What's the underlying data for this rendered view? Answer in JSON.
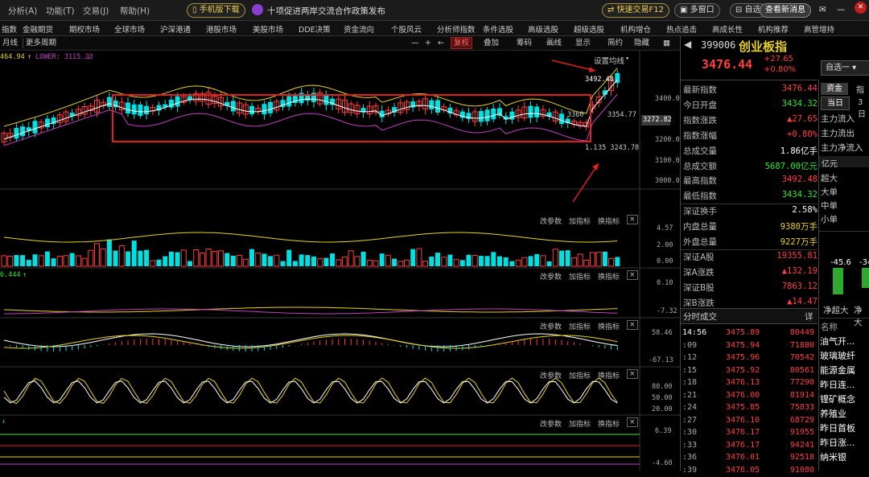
{
  "menubar": {
    "items": [
      "分析(A)",
      "功能(T)",
      "交易(J)",
      "帮助(H)"
    ],
    "mobile_btn": "手机版下载",
    "news": "十项促进两岸交流合作政策发布",
    "fast_trade": "快速交易F12",
    "multi_window": "多窗口",
    "self_select": "自选",
    "check_news": "查看新消息"
  },
  "navbar": {
    "items": [
      "指数",
      "金融期货",
      "期权市场",
      "全球市场",
      "沪深港通",
      "港股市场",
      "美股市场",
      "DDE决策",
      "资金流向",
      "个股风云",
      "分析师指数",
      "条件选股",
      "高级选股",
      "超级选股",
      "机构增仓",
      "热点追击",
      "高成长性",
      "机构推荐",
      "高管增持"
    ]
  },
  "toolbar": {
    "left": [
      "月线",
      "更多周期"
    ],
    "buttons": [
      "复权",
      "叠加",
      "筹码",
      "画线",
      "显示",
      "简约",
      "隐藏"
    ],
    "ma_setting": "设置均线"
  },
  "indicator": {
    "top_text": "464.94",
    "lower_text": "LOWER: 3115.23",
    "annot_high": "3492.48",
    "annot_mid_left": "3360",
    "annot_mid": "3354.77",
    "annot_low": "35 3243.78",
    "annot_low_prefix": "1.1",
    "sub2_text": "6.444"
  },
  "axis": {
    "main": [
      "3400.00",
      "3272.82",
      "3200.00",
      "3100.00",
      "3000.00"
    ],
    "vol": [
      "4.57",
      "2.00",
      "0.00"
    ],
    "sub2": [
      "0.10",
      "-7.32"
    ],
    "sub3": [
      "58.46",
      "-67.13"
    ],
    "sub4": [
      "80.00",
      "50.00",
      "20.00"
    ],
    "sub5": [
      "6.39",
      "-4.60"
    ]
  },
  "sub_controls": {
    "params": "改参数",
    "add": "加指标",
    "switch": "换指标",
    "close": "×"
  },
  "header": {
    "code": "399006",
    "name": "创业板指",
    "price": "3476.44",
    "change": "+27.65",
    "change_pct": "+0.80%",
    "select_btn": "自选一"
  },
  "stats": [
    {
      "k": "最新指数",
      "v": "3476.44",
      "c": "red"
    },
    {
      "k": "今日开盘",
      "v": "3434.32",
      "c": "green"
    },
    {
      "k": "指数涨跌",
      "v": "▲27.65",
      "c": "red"
    },
    {
      "k": "指数涨幅",
      "v": "+0.80%",
      "c": "red"
    },
    {
      "k": "总成交量",
      "v": "1.86亿手",
      "c": "white"
    },
    {
      "k": "总成交额",
      "v": "5687.00亿元",
      "c": "green"
    },
    {
      "k": "最高指数",
      "v": "3492.48",
      "c": "red"
    },
    {
      "k": "最低指数",
      "v": "3434.32",
      "c": "green"
    },
    {
      "k": "深证换手",
      "v": "2.58%",
      "c": "white"
    },
    {
      "k": "内盘总量",
      "v": "9380万手",
      "c": "yellowt"
    },
    {
      "k": "外盘总量",
      "v": "9227万手",
      "c": "yellowt"
    },
    {
      "k": "深证A股",
      "v": "19355.81",
      "c": "red"
    },
    {
      "k": "深A涨跌",
      "v": "▲132.19",
      "c": "red"
    },
    {
      "k": "深证B股",
      "v": "7863.12",
      "c": "red"
    },
    {
      "k": "深B涨跌",
      "v": "▲14.47",
      "c": "red"
    }
  ],
  "trades_title": "分时成交",
  "trades_detail": "详",
  "trades": [
    {
      "t": "14:56",
      "p": "3475.89",
      "v": "80449"
    },
    {
      "t": ":09",
      "p": "3475.94",
      "v": "71880"
    },
    {
      "t": ":12",
      "p": "3475.96",
      "v": "70542"
    },
    {
      "t": ":15",
      "p": "3475.92",
      "v": "80561"
    },
    {
      "t": ":18",
      "p": "3476.13",
      "v": "77290"
    },
    {
      "t": ":21",
      "p": "3476.00",
      "v": "81914"
    },
    {
      "t": ":24",
      "p": "3475.85",
      "v": "75833"
    },
    {
      "t": ":27",
      "p": "3476.10",
      "v": "68729"
    },
    {
      "t": ":30",
      "p": "3476.17",
      "v": "91955"
    },
    {
      "t": ":33",
      "p": "3476.17",
      "v": "94241"
    },
    {
      "t": ":36",
      "p": "3476.01",
      "v": "92518"
    },
    {
      "t": ":39",
      "p": "3476.05",
      "v": "91080"
    }
  ],
  "fund_tabs": [
    "资金",
    "指"
  ],
  "day_tabs": [
    "当日",
    "3日"
  ],
  "fund_rows": [
    "主力流入",
    "主力流出",
    "主力净流入"
  ],
  "yi_label": "亿元",
  "size_rows": [
    "超大",
    "大单",
    "中单",
    "小单"
  ],
  "bar_labels": [
    "-45.6",
    "-34"
  ],
  "net_labels": [
    "净超大",
    "净大"
  ],
  "sector_title": "名称",
  "sectors": [
    "油气开...",
    "玻璃玻纤",
    "能源金属",
    "昨日连...",
    "锂矿概念",
    "养殖业",
    "昨日首板",
    "昨日涨...",
    "纳米银"
  ]
}
